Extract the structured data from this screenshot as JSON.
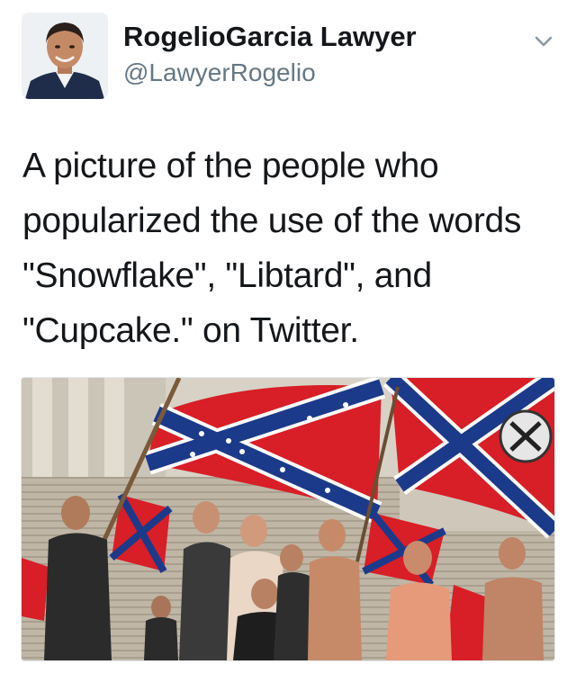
{
  "author": {
    "display_name": "RogelioGarcia Lawyer",
    "handle": "@LawyerRogelio",
    "avatar_icon": "profile-photo"
  },
  "tweet": {
    "text": "A picture of the people who popularized the use of the words \"Snowflake\", \"Libtard\", and \"Cupcake.\" on Twitter."
  },
  "menu": {
    "icon": "chevron-down-icon"
  },
  "media": {
    "kind": "photo",
    "subject": "crowd-with-confederate-flags"
  },
  "colors": {
    "name": "#14171a",
    "handle": "#657786",
    "flag_red": "#d81e26",
    "flag_blue": "#1c3a8a"
  }
}
